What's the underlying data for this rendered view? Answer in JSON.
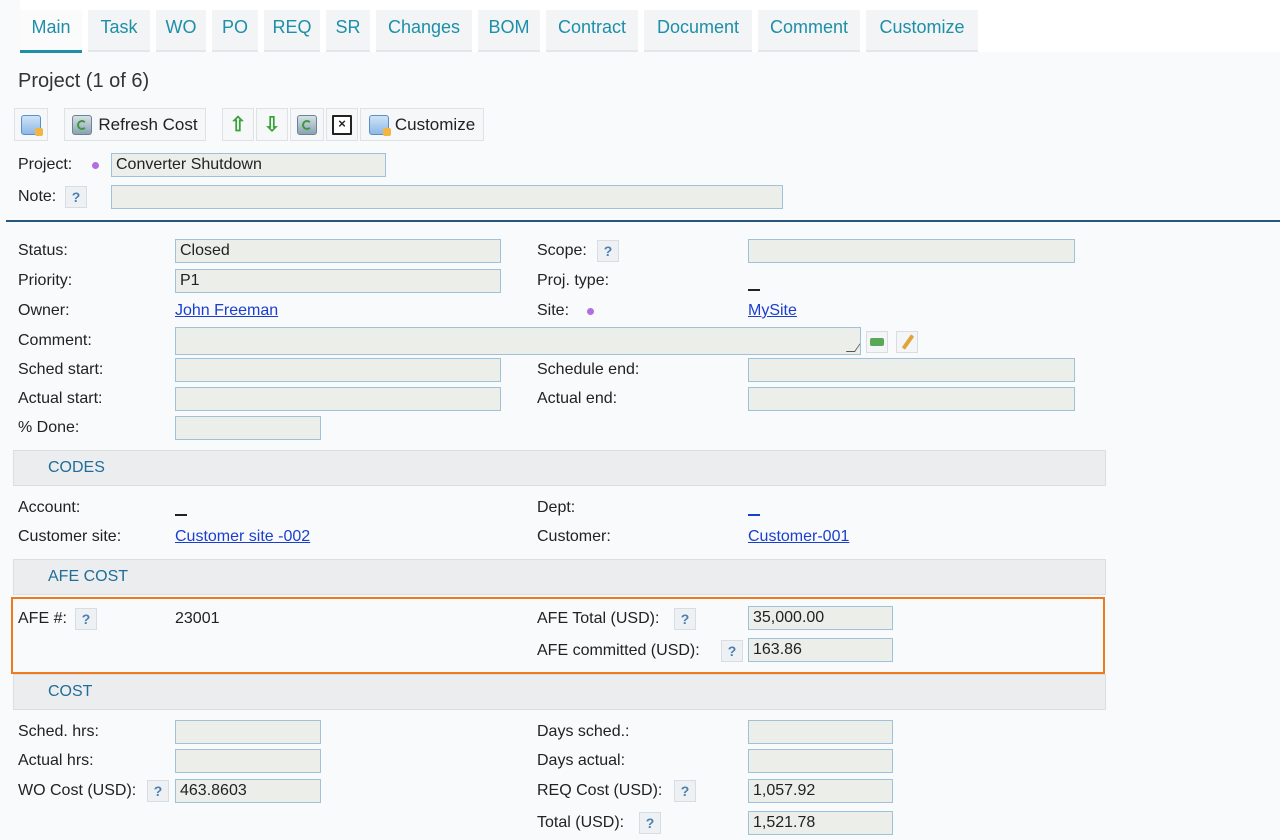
{
  "tabs": [
    "Main",
    "Task",
    "WO",
    "PO",
    "REQ",
    "SR",
    "Changes",
    "BOM",
    "Contract",
    "Document",
    "Comment",
    "Customize"
  ],
  "title": "Project (1 of 6)",
  "toolbar": {
    "refresh_label": "Refresh Cost",
    "customize_label": "Customize"
  },
  "header": {
    "project_label": "Project:",
    "project_value": "Converter Shutdown",
    "note_label": "Note:",
    "note_value": "",
    "help_glyph": "?"
  },
  "main": {
    "status_label": "Status:",
    "status_value": "Closed",
    "priority_label": "Priority:",
    "priority_value": "P1",
    "owner_label": "Owner:",
    "owner_value": "John Freeman",
    "comment_label": "Comment:",
    "comment_value": "",
    "sched_start_label": "Sched start:",
    "sched_start_value": "",
    "actual_start_label": "Actual start:",
    "actual_start_value": "",
    "done_label": "% Done:",
    "done_value": "",
    "scope_label": "Scope:",
    "scope_value": "",
    "proj_type_label": "Proj. type:",
    "site_label": "Site:",
    "site_value": "MySite",
    "schedule_end_label": "Schedule end:",
    "schedule_end_value": "",
    "actual_end_label": "Actual end:",
    "actual_end_value": ""
  },
  "codes": {
    "section_title": "CODES",
    "account_label": "Account:",
    "customer_site_label": "Customer site:",
    "customer_site_value": "Customer site -002",
    "dept_label": "Dept:",
    "customer_label": "Customer:",
    "customer_value": "Customer-001"
  },
  "afe": {
    "section_title": "AFE COST",
    "afe_no_label": "AFE #:",
    "afe_no_value": "23001",
    "afe_total_label": "AFE Total (USD):",
    "afe_total_value": "35,000.00",
    "afe_committed_label": "AFE committed (USD):",
    "afe_committed_value": "163.86"
  },
  "cost": {
    "section_title": "COST",
    "sched_hrs_label": "Sched. hrs:",
    "sched_hrs_value": "",
    "actual_hrs_label": "Actual hrs:",
    "actual_hrs_value": "",
    "wo_cost_label": "WO Cost (USD):",
    "wo_cost_value": "463.8603",
    "days_sched_label": "Days sched.:",
    "days_sched_value": "",
    "days_actual_label": "Days actual:",
    "days_actual_value": "",
    "req_cost_label": "REQ Cost (USD):",
    "req_cost_value": "1,057.92",
    "total_label": "Total (USD):",
    "total_value": "1,521.78"
  }
}
